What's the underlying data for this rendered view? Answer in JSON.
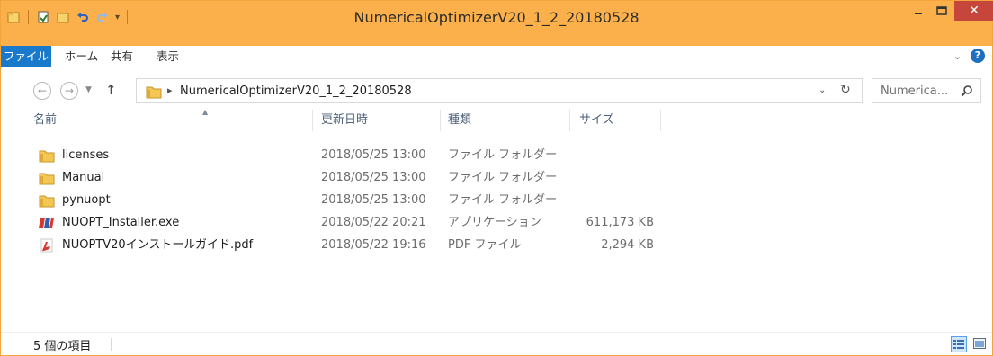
{
  "window": {
    "title": "NumericalOptimizerV20_1_2_20180528",
    "accent_color": "#fbb04b",
    "close_label": "✕"
  },
  "ribbon": {
    "tabs": [
      {
        "label": "ファイル",
        "active": true
      },
      {
        "label": "ホーム"
      },
      {
        "label": "共有"
      },
      {
        "label": "表示"
      }
    ]
  },
  "address": {
    "path": "NumericalOptimizerV20_1_2_20180528"
  },
  "search": {
    "placeholder": "Numerica..."
  },
  "columns": {
    "name": "名前",
    "date": "更新日時",
    "type": "種類",
    "size": "サイズ"
  },
  "files": [
    {
      "name": "licenses",
      "date": "2018/05/25 13:00",
      "type": "ファイル フォルダー",
      "size": "",
      "icon": "folder-icon"
    },
    {
      "name": "Manual",
      "date": "2018/05/25 13:00",
      "type": "ファイル フォルダー",
      "size": "",
      "icon": "folder-icon"
    },
    {
      "name": "pynuopt",
      "date": "2018/05/25 13:00",
      "type": "ファイル フォルダー",
      "size": "",
      "icon": "folder-icon"
    },
    {
      "name": "NUOPT_Installer.exe",
      "date": "2018/05/22 20:21",
      "type": "アプリケーション",
      "size": "611,173 KB",
      "icon": "installer-icon"
    },
    {
      "name": "NUOPTV20インストールガイド.pdf",
      "date": "2018/05/22 19:16",
      "type": "PDF ファイル",
      "size": "2,294 KB",
      "icon": "pdf-icon"
    }
  ],
  "status": {
    "item_count": "5 個の項目"
  }
}
